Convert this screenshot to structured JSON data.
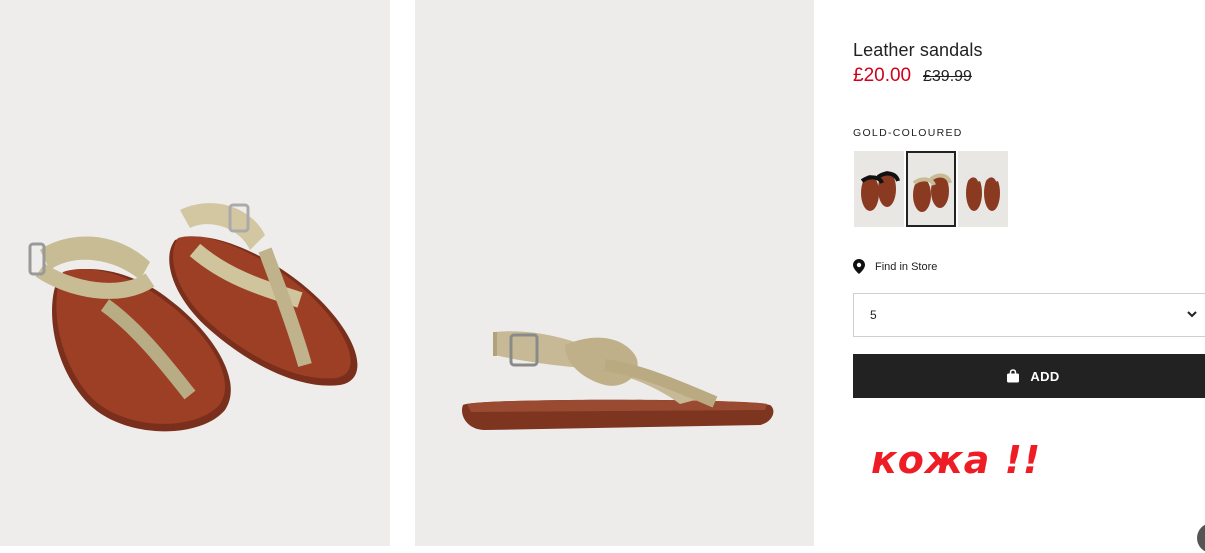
{
  "product": {
    "title": "Leather sandals",
    "price_current": "£20.00",
    "price_original": "£39.99",
    "colour_label": "GOLD-COLOURED",
    "swatches": [
      {
        "name": "black",
        "selected": false
      },
      {
        "name": "gold-coloured",
        "selected": true
      },
      {
        "name": "silver-coloured",
        "selected": false
      }
    ],
    "find_in_store": "Find in Store",
    "size_value": "5",
    "add_label": "ADD"
  },
  "annotation": "кожа !!",
  "colors": {
    "sale_red": "#d0021b",
    "button_black": "#222222",
    "annotation_red": "#ee1c24",
    "sole_brown": "#8b3a22",
    "strap_gold": "#c8bc95"
  },
  "icons": [
    "map-pin-icon",
    "chevron-down-icon",
    "shopping-bag-icon"
  ]
}
